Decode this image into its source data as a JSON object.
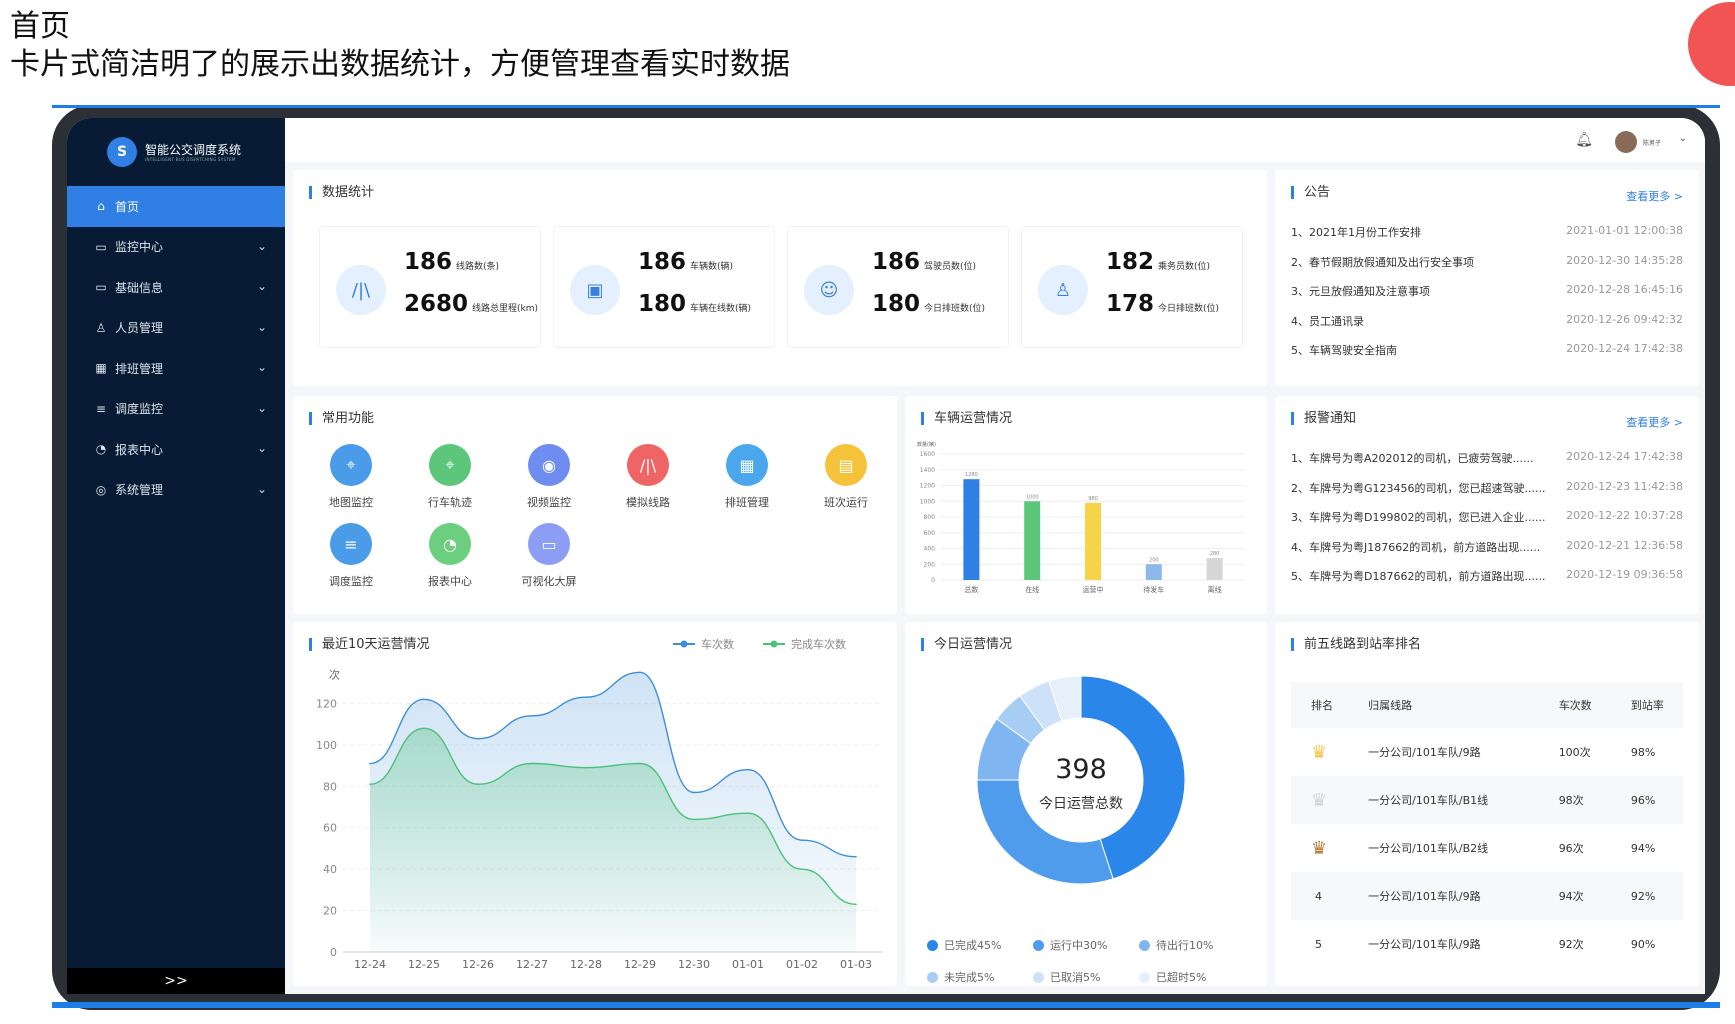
{
  "slide": {
    "title": "首页",
    "subtitle": "卡片式简洁明了的展示出数据统计，方便管理查看实时数据"
  },
  "app": {
    "name": "智能公交调度系统",
    "name_en": "INTELLIGENT BUS DISPATCHING SYSTEM",
    "logo_letter": "S",
    "user": "陈男子",
    "collapse": ">>"
  },
  "nav": [
    {
      "label": "首页",
      "icon": "home-icon",
      "glyph": "⌂",
      "active": true
    },
    {
      "label": "监控中心",
      "icon": "monitor-icon",
      "glyph": "▭"
    },
    {
      "label": "基础信息",
      "icon": "display-icon",
      "glyph": "▭"
    },
    {
      "label": "人员管理",
      "icon": "user-icon",
      "glyph": "♙"
    },
    {
      "label": "排班管理",
      "icon": "calendar-icon",
      "glyph": "▦"
    },
    {
      "label": "调度监控",
      "icon": "sliders-icon",
      "glyph": "≡"
    },
    {
      "label": "报表中心",
      "icon": "pie-icon",
      "glyph": "◔"
    },
    {
      "label": "系统管理",
      "icon": "settings-icon",
      "glyph": "◎"
    }
  ],
  "stats": {
    "title": "数据统计",
    "cards": [
      {
        "icon": "route-icon",
        "glyph": "/|\\",
        "top_value": "186",
        "top_label": "线路数(条)",
        "bottom_value": "2680",
        "bottom_label": "线路总里程(km)"
      },
      {
        "icon": "bus-icon",
        "glyph": "▣",
        "top_value": "186",
        "top_label": "车辆数(辆)",
        "bottom_value": "180",
        "bottom_label": "车辆在线数(辆)"
      },
      {
        "icon": "driver-icon",
        "glyph": "☺",
        "top_value": "186",
        "top_label": "驾驶员数(位)",
        "bottom_value": "180",
        "bottom_label": "今日排班数(位)"
      },
      {
        "icon": "conductor-icon",
        "glyph": "♙",
        "top_value": "182",
        "top_label": "乘务员数(位)",
        "bottom_value": "178",
        "bottom_label": "今日排班数(位)"
      }
    ]
  },
  "notice": {
    "title": "公告",
    "more": "查看更多 >",
    "items": [
      {
        "text": "1、2021年1月份工作安排",
        "time": "2021-01-01 12:00:38"
      },
      {
        "text": "2、春节假期放假通知及出行安全事项",
        "time": "2020-12-30 14:35:28"
      },
      {
        "text": "3、元旦放假通知及注意事项",
        "time": "2020-12-28 16:45:16"
      },
      {
        "text": "4、员工通讯录",
        "time": "2020-12-26 09:42:32"
      },
      {
        "text": "5、车辆驾驶安全指南",
        "time": "2020-12-24 17:42:38"
      }
    ]
  },
  "functions": {
    "title": "常用功能",
    "items": [
      {
        "label": "地图监控",
        "icon": "map-icon",
        "glyph": "⌖",
        "color": "#4a9be8"
      },
      {
        "label": "行车轨迹",
        "icon": "track-icon",
        "glyph": "⌖",
        "color": "#5cc77a"
      },
      {
        "label": "视频监控",
        "icon": "camera-icon",
        "glyph": "◉",
        "color": "#6f8cf0"
      },
      {
        "label": "模拟线路",
        "icon": "road-icon",
        "glyph": "/|\\",
        "color": "#ef6565"
      },
      {
        "label": "排班管理",
        "icon": "schedule-icon",
        "glyph": "▦",
        "color": "#4aa7ee"
      },
      {
        "label": "班次运行",
        "icon": "clipboard-icon",
        "glyph": "▤",
        "color": "#f5c33b"
      },
      {
        "label": "调度监控",
        "icon": "dispatch-icon",
        "glyph": "≡",
        "color": "#4a9be8"
      },
      {
        "label": "报表中心",
        "icon": "report-icon",
        "glyph": "◔",
        "color": "#6bcf7f"
      },
      {
        "label": "可视化大屏",
        "icon": "screen-icon",
        "glyph": "▭",
        "color": "#8b9ef3"
      }
    ]
  },
  "vehicle_chart_title": "车辆运营情况",
  "trend_chart_title": "最近10天运营情况",
  "today_chart_title": "今日运营情况",
  "alarm": {
    "title": "报警通知",
    "more": "查看更多 >",
    "items": [
      {
        "text": "1、车牌号为粤A202012的司机，已疲劳驾驶......",
        "time": "2020-12-24 17:42:38"
      },
      {
        "text": "2、车牌号为粤G123456的司机，您已超速驾驶......",
        "time": "2020-12-23 11:42:38"
      },
      {
        "text": "3、车牌号为粤D199802的司机，您已进入企业......",
        "time": "2020-12-22 10:37:28"
      },
      {
        "text": "4、车牌号为粤J187662的司机，前方道路出现......",
        "time": "2020-12-21 12:36:58"
      },
      {
        "text": "5、车牌号为粤D187662的司机，前方道路出现......",
        "time": "2020-12-19 09:36:58"
      }
    ]
  },
  "ranking": {
    "title": "前五线路到站率排名",
    "headers": [
      "排名",
      "归属线路",
      "车次数",
      "到站率"
    ],
    "rows": [
      {
        "rank": "1",
        "medal": "gold",
        "line": "一分公司/101车队/9路",
        "trips": "100次",
        "rate": "98%"
      },
      {
        "rank": "2",
        "medal": "silver",
        "line": "一分公司/101车队/B1线",
        "trips": "98次",
        "rate": "96%"
      },
      {
        "rank": "3",
        "medal": "bronze",
        "line": "一分公司/101车队/B2线",
        "trips": "96次",
        "rate": "94%"
      },
      {
        "rank": "4",
        "medal": "",
        "line": "一分公司/101车队/9路",
        "trips": "94次",
        "rate": "92%"
      },
      {
        "rank": "5",
        "medal": "",
        "line": "一分公司/101车队/9路",
        "trips": "92次",
        "rate": "90%"
      }
    ]
  },
  "chart_data": [
    {
      "type": "bar",
      "title": "车辆运营情况",
      "ylabel": "数量(辆)",
      "categories": [
        "总数",
        "在线",
        "运营中",
        "待发车",
        "离线"
      ],
      "values": [
        1280,
        1000,
        980,
        200,
        280
      ],
      "colors": [
        "#2f7fe4",
        "#5cc77a",
        "#f7d34a",
        "#8db8ec",
        "#d6d6d6"
      ],
      "yticks": [
        0,
        200,
        400,
        600,
        800,
        1000,
        1200,
        1400,
        1600
      ],
      "ylim": [
        0,
        1600
      ]
    },
    {
      "type": "area",
      "title": "最近10天运营情况",
      "ylabel": "次",
      "x": [
        "12-24",
        "12-25",
        "12-26",
        "12-27",
        "12-28",
        "12-29",
        "12-30",
        "01-01",
        "01-02",
        "01-03"
      ],
      "yticks": [
        0,
        20,
        40,
        60,
        80,
        100,
        120
      ],
      "ylim": [
        0,
        140
      ],
      "series": [
        {
          "name": "车次数",
          "color": "#3e8fd8",
          "values": [
            91,
            122,
            103,
            114,
            123,
            135,
            77,
            88,
            54,
            46
          ]
        },
        {
          "name": "完成车次数",
          "color": "#4cc07a",
          "values": [
            81,
            108,
            81,
            91,
            89,
            91,
            64,
            67,
            40,
            23
          ]
        }
      ]
    },
    {
      "type": "pie",
      "title": "今日运营情况",
      "center_value": "398",
      "center_label": "今日运营总数",
      "slices": [
        {
          "name": "已完成45%",
          "value": 45,
          "color": "#2b86ea"
        },
        {
          "name": "运行中30%",
          "value": 30,
          "color": "#4f9ced"
        },
        {
          "name": "待出行10%",
          "value": 10,
          "color": "#7fb5f1"
        },
        {
          "name": "未完成5%",
          "value": 5,
          "color": "#a8cdf5"
        },
        {
          "name": "已取消5%",
          "value": 5,
          "color": "#cde2f9"
        },
        {
          "name": "已超时5%",
          "value": 5,
          "color": "#e6f0fb"
        }
      ]
    }
  ]
}
